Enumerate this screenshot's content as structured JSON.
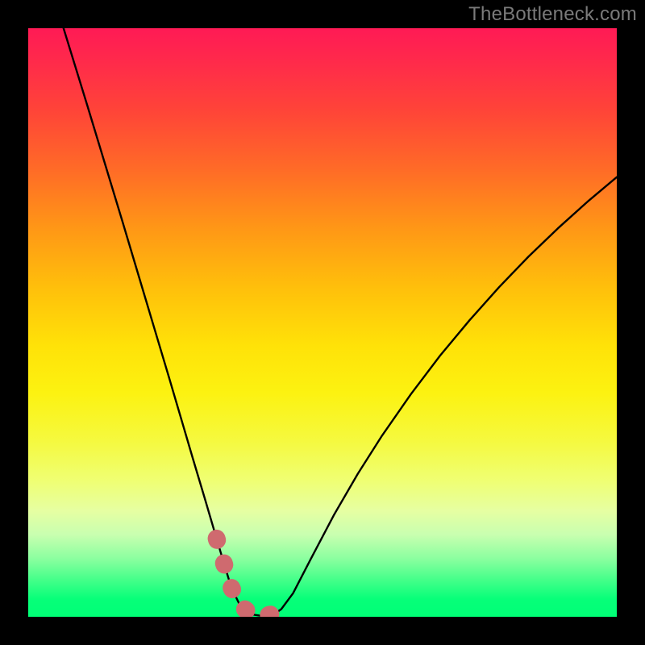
{
  "watermark": "TheBottleneck.com",
  "chart_data": {
    "type": "line",
    "title": "",
    "xlabel": "",
    "ylabel": "",
    "xlim": [
      0,
      1
    ],
    "ylim": [
      0,
      1
    ],
    "series": [
      {
        "name": "bottleneck-curve",
        "x": [
          0.06,
          0.08,
          0.1,
          0.12,
          0.14,
          0.16,
          0.18,
          0.2,
          0.22,
          0.24,
          0.26,
          0.28,
          0.3,
          0.32,
          0.334,
          0.345,
          0.36,
          0.38,
          0.4,
          0.42,
          0.43,
          0.45,
          0.48,
          0.52,
          0.56,
          0.6,
          0.65,
          0.7,
          0.75,
          0.8,
          0.85,
          0.9,
          0.95,
          1.0
        ],
        "values": [
          1.0,
          0.935,
          0.87,
          0.804,
          0.738,
          0.672,
          0.605,
          0.538,
          0.471,
          0.404,
          0.336,
          0.268,
          0.201,
          0.133,
          0.086,
          0.05,
          0.019,
          0.004,
          0.001,
          0.006,
          0.013,
          0.04,
          0.098,
          0.174,
          0.243,
          0.306,
          0.378,
          0.444,
          0.504,
          0.56,
          0.612,
          0.66,
          0.705,
          0.747
        ]
      }
    ],
    "highlight": {
      "name": "optimal-zone",
      "x": [
        0.32,
        0.334,
        0.345,
        0.36,
        0.38,
        0.4,
        0.42,
        0.43
      ],
      "values": [
        0.133,
        0.086,
        0.05,
        0.019,
        0.004,
        0.001,
        0.006,
        0.013
      ]
    }
  },
  "colors": {
    "curve": "#000000",
    "highlight": "#cf6a6f"
  }
}
